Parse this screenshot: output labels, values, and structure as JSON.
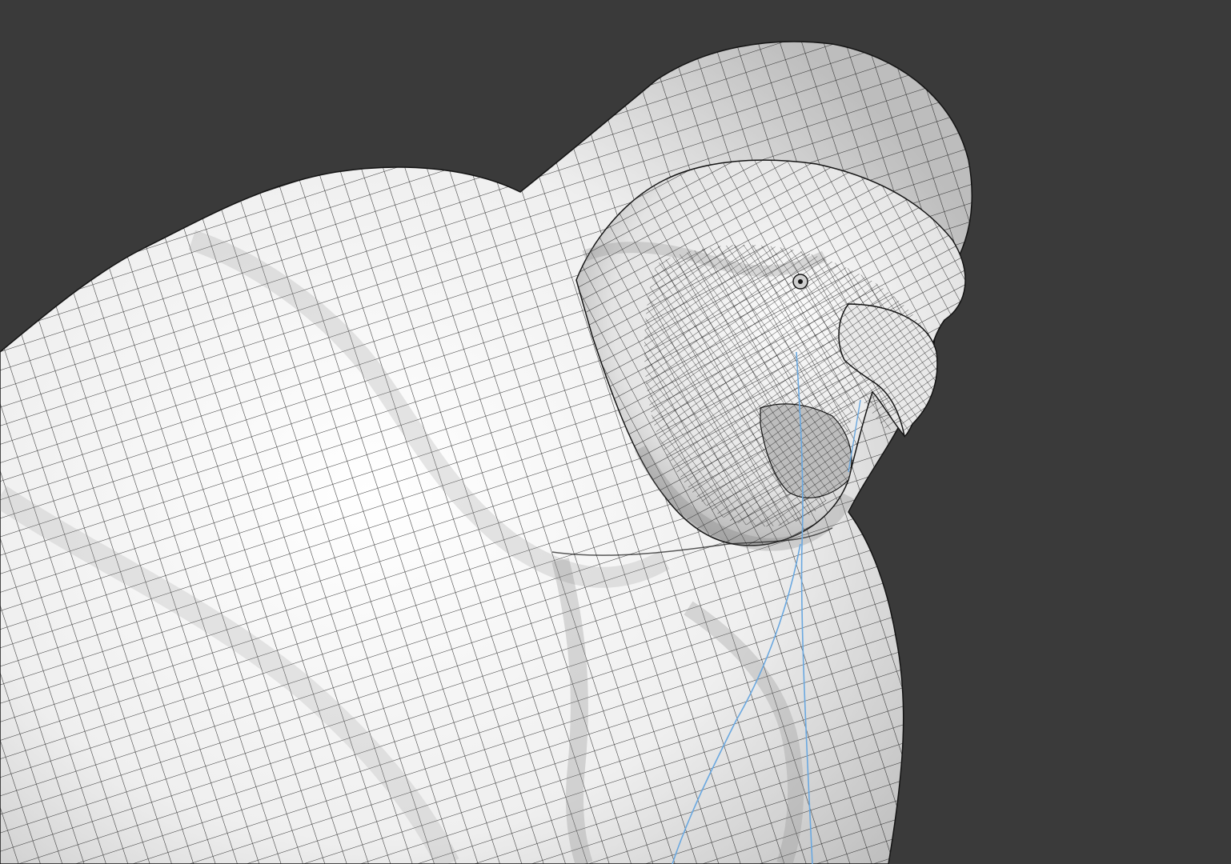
{
  "viewport": {
    "background_color": "#3a3a3a",
    "mesh_fill_color": "#f2f2f2",
    "mesh_shadow_color": "#c9c9c9",
    "wire_color": "#141414",
    "guide_curve_color": "#6aa8e0",
    "subject": "wireframe-creature-sculpt"
  }
}
